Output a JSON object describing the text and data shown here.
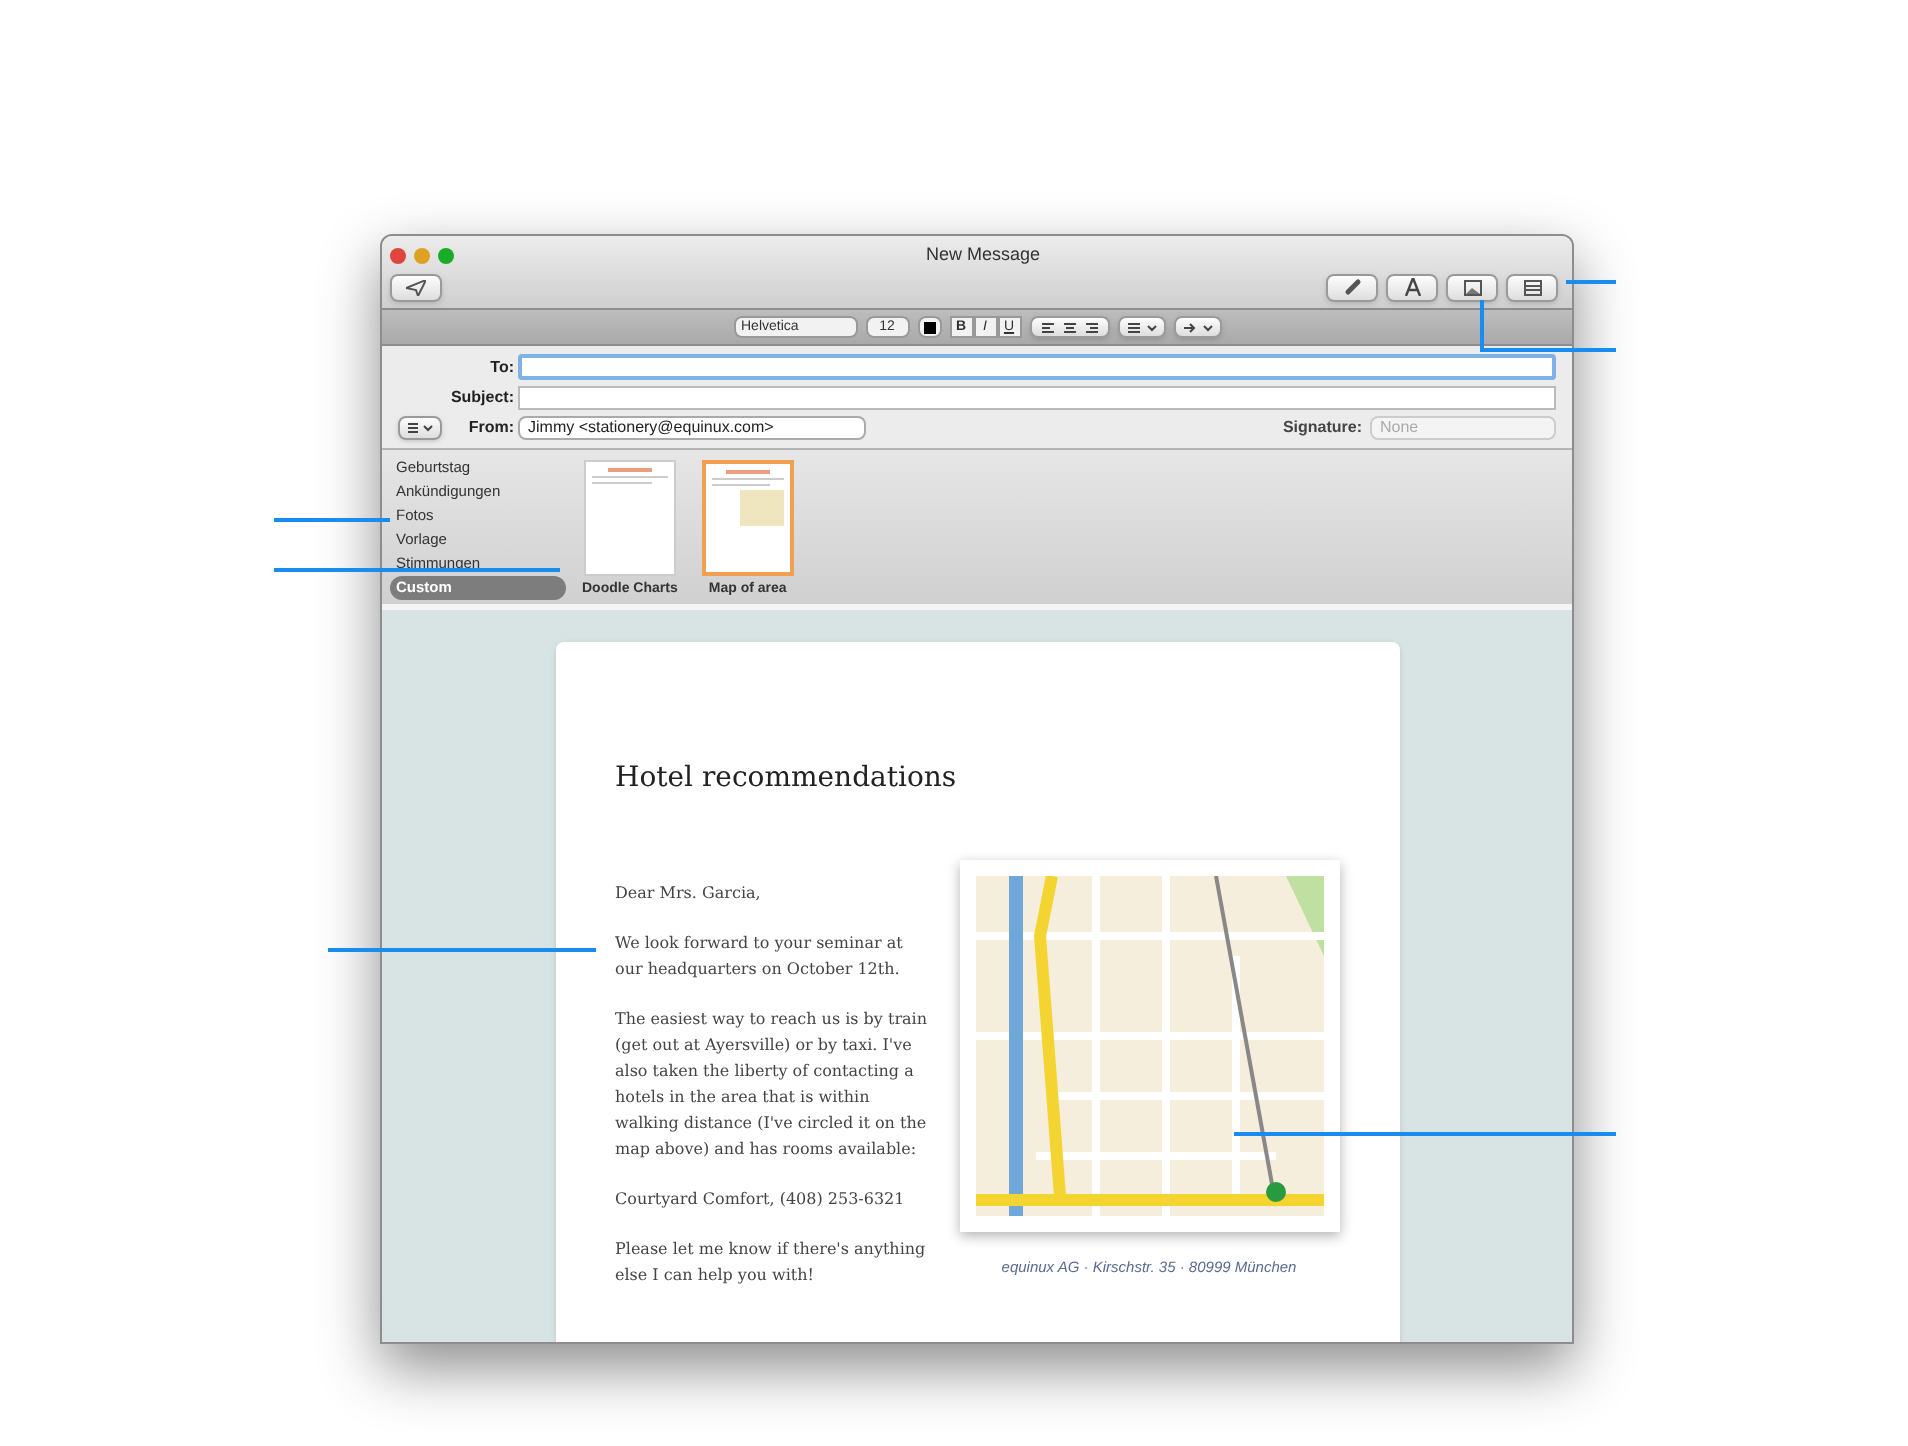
{
  "window": {
    "title": "New Message"
  },
  "format_bar": {
    "font": "Helvetica",
    "size": "12",
    "styles": [
      "B",
      "I",
      "U"
    ]
  },
  "header": {
    "to_label": "To:",
    "subject_label": "Subject:",
    "from_label": "From:",
    "from_value": "Jimmy <stationery@equinux.com>",
    "signature_label": "Signature:",
    "signature_value": "None"
  },
  "categories": [
    {
      "label": "Geburtstag",
      "selected": false
    },
    {
      "label": "Ankündigungen",
      "selected": false
    },
    {
      "label": "Fotos",
      "selected": false
    },
    {
      "label": "Vorlage",
      "selected": false
    },
    {
      "label": "Stimmungen",
      "selected": false
    },
    {
      "label": "Custom",
      "selected": true
    }
  ],
  "templates": [
    {
      "label": "Doodle Charts",
      "selected": false
    },
    {
      "label": "Map of area",
      "selected": true
    }
  ],
  "letter": {
    "heading": "Hotel recommendations",
    "paragraphs": [
      "Dear Mrs. Garcia,",
      "We look forward to your seminar at our headquarters on October 12th.",
      "The easiest way to reach us is by train (get out at Ayersville) or by  taxi. I've also taken the liberty of contacting a hotels in the area that is within walking distance (I've circled it on the map above) and has rooms available:",
      "Courtyard Comfort, (408) 253-6321",
      "Please let me know if there's anything else I can help you with!"
    ],
    "caption": "equinux AG · Kirschstr. 35 · 80999 München"
  }
}
